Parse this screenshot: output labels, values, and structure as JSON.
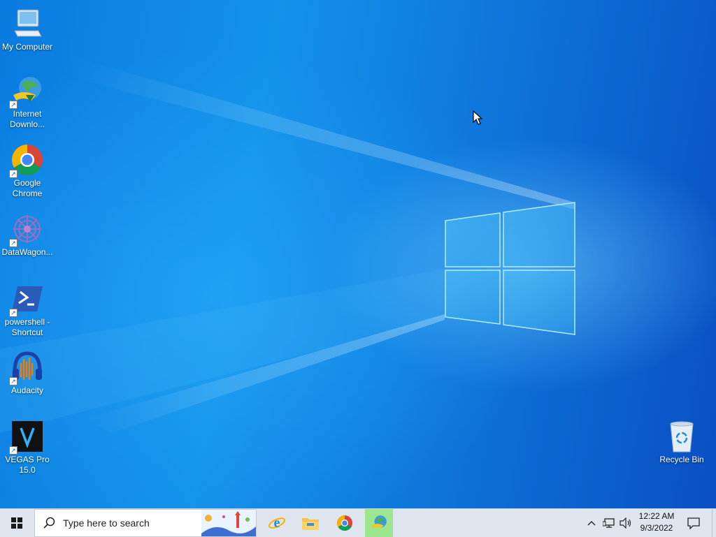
{
  "desktop": {
    "icons": [
      {
        "label_line1": "My Computer",
        "label_line2": "",
        "icon": "computer-icon"
      },
      {
        "label_line1": "Internet",
        "label_line2": "Downlo...",
        "icon": "internet-download-manager-icon"
      },
      {
        "label_line1": "Google",
        "label_line2": "Chrome",
        "icon": "chrome-icon"
      },
      {
        "label_line1": "DataWagon...",
        "label_line2": "",
        "icon": "datawagon-icon"
      },
      {
        "label_line1": "powershell -",
        "label_line2": "Shortcut",
        "icon": "powershell-icon"
      },
      {
        "label_line1": "Audacity",
        "label_line2": "",
        "icon": "audacity-icon"
      },
      {
        "label_line1": "VEGAS Pro",
        "label_line2": "15.0",
        "icon": "vegas-pro-icon"
      },
      {
        "label_line1": "Recycle Bin",
        "label_line2": "",
        "icon": "recycle-bin-icon"
      }
    ]
  },
  "taskbar": {
    "search_placeholder": "Type here to search",
    "pinned": [
      "internet-explorer-icon",
      "file-explorer-icon",
      "chrome-icon",
      "internet-download-manager-icon"
    ],
    "active_app": "internet-download-manager-icon",
    "time": "12:22 AM",
    "date": "9/3/2022"
  },
  "colors": {
    "desktop_blue": "#0b6fd6",
    "taskbar": "#dfe5ee",
    "active_app_highlight": "#9be68f"
  }
}
